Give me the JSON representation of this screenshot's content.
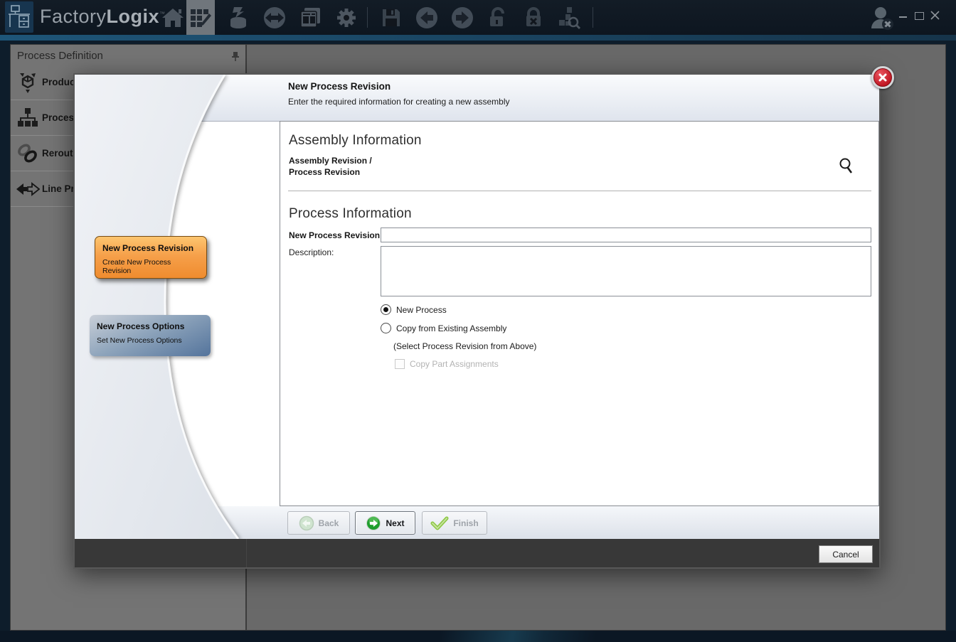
{
  "topbar": {
    "brand": {
      "factory": "Factory",
      "logix": "Logix",
      "tm": "™"
    },
    "icons": [
      "home-icon",
      "process-grid-edit-icon",
      "import-database-icon",
      "sync-icon",
      "reports-icon",
      "settings-gear-icon",
      "save-icon",
      "nav-back-icon",
      "nav-forward-icon",
      "unlock-icon",
      "lock-x-icon",
      "assembly-search-icon",
      "user-logout-icon"
    ]
  },
  "sidebar": {
    "title": "Process Definition",
    "items": [
      {
        "icon": "product-cube-icon",
        "label": "Produc"
      },
      {
        "icon": "process-tree-icon",
        "label": "Proces"
      },
      {
        "icon": "reroute-links-icon",
        "label": "Rerout"
      },
      {
        "icon": "line-arrows-icon",
        "label": "Line Pr"
      }
    ]
  },
  "dialog": {
    "title": "New Process Revision",
    "subtitle": "Enter the required information for creating a new assembly",
    "steps": [
      {
        "title": "New Process Revision",
        "subtitle": "Create New Process Revision",
        "state": "active",
        "color": "#f6a04a"
      },
      {
        "title": "New Process Options",
        "subtitle": "Set New Process Options",
        "state": "upcoming",
        "color": "#54749c"
      }
    ],
    "assembly": {
      "heading": "Assembly Information",
      "label1": "Assembly Revision /",
      "label2": "Process Revision"
    },
    "process": {
      "heading": "Process Information",
      "revision_label": "New Process Revision:",
      "revision_value": "",
      "description_label": "Description:",
      "description_value": "",
      "options": [
        {
          "label": "New Process",
          "selected": true
        },
        {
          "label": "Copy from Existing Assembly",
          "selected": false
        }
      ],
      "note": "(Select Process Revision from Above)",
      "copy_parts": {
        "label": "Copy Part Assignments",
        "checked": false,
        "enabled": false
      }
    },
    "footer": {
      "back": "Back",
      "next": "Next",
      "finish": "Finish",
      "cancel": "Cancel"
    }
  }
}
